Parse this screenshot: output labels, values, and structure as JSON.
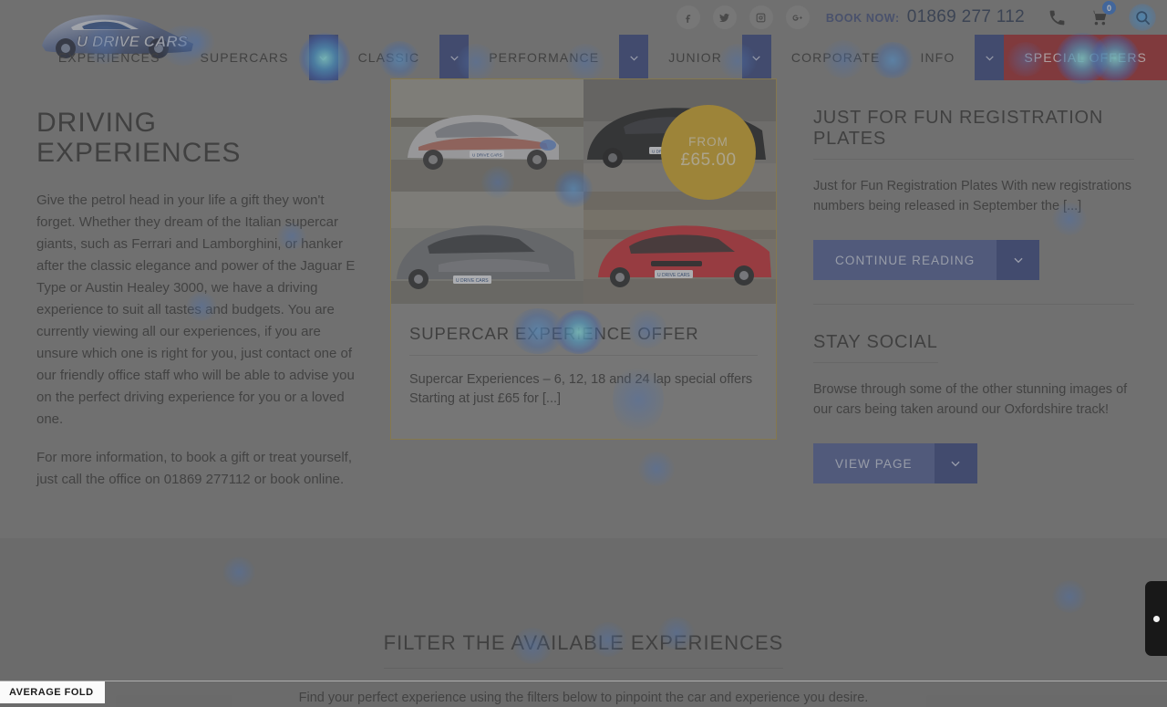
{
  "site": {
    "logo_text": "U DRIVE CARS",
    "logo_icon": "car-logo-icon"
  },
  "topbar": {
    "social": [
      {
        "name": "facebook-icon",
        "label": "f"
      },
      {
        "name": "twitter-icon",
        "label": "t"
      },
      {
        "name": "instagram-icon",
        "label": "i"
      },
      {
        "name": "googleplus-icon",
        "label": "g+"
      }
    ],
    "book_now_label": "BOOK NOW:",
    "phone": "01869 277 112",
    "phone_icon": "phone-icon",
    "cart_icon": "cart-icon",
    "cart_count": "0",
    "search_icon": "search-icon"
  },
  "nav": {
    "items": [
      {
        "label": "EXPERIENCES",
        "caret": false
      },
      {
        "label": "SUPERCARS",
        "caret": true
      },
      {
        "label": "CLASSIC",
        "caret": true
      },
      {
        "label": "PERFORMANCE",
        "caret": true
      },
      {
        "label": "JUNIOR",
        "caret": true
      },
      {
        "label": "CORPORATE",
        "caret": false
      },
      {
        "label": "INFO",
        "caret": true
      }
    ],
    "special_offers": "SPECIAL OFFERS",
    "caret_icon": "chevron-down-icon",
    "accent_blue": "#2e3f7f",
    "accent_red": "#9e1f26"
  },
  "left": {
    "title": "DRIVING EXPERIENCES",
    "paragraph1": "Give the petrol head in your life a gift they won't forget. Whether they dream of the Italian supercar giants, such as Ferrari and Lamborghini, or hanker after the classic elegance and power of the Jaguar E Type or Austin Healey 3000, we have a driving experience to suit all tastes and budgets. You are currently viewing all our experiences, if you are unsure which one is right for you, just contact one of our friendly office staff who will be able to advise you on the perfect driving experience for you or a loved one.",
    "paragraph2": "For more information, to book a gift or treat yourself, just call the office on 01869 277112 or book online."
  },
  "card": {
    "badge_label": "FROM",
    "badge_price": "£65.00",
    "badge_color": "#d4a61e",
    "border_color": "#a89144",
    "title": "SUPERCAR EXPERIENCE OFFER",
    "excerpt": "Supercar Experiences – 6, 12, 18 and 24 lap special offers Starting at just £65 for [...]",
    "images": [
      {
        "name": "thumb-silver-ferrari",
        "alt": "Silver supercar on track"
      },
      {
        "name": "thumb-black-supercar",
        "alt": "Black supercar on track"
      },
      {
        "name": "thumb-grey-aston",
        "alt": "Grey Aston Martin on track"
      },
      {
        "name": "thumb-red-audi",
        "alt": "Red Audi R8 on track"
      }
    ]
  },
  "widgets": [
    {
      "title": "JUST FOR FUN REGISTRATION PLATES",
      "text": "Just for Fun Registration Plates   With new registrations numbers being released in September the [...]",
      "button": "CONTINUE READING",
      "button_caret_icon": "chevron-down-icon"
    },
    {
      "title": "STAY SOCIAL",
      "text": "Browse through some of the other stunning images of our cars being taken around our Oxfordshire track!",
      "button": "VIEW PAGE",
      "button_caret_icon": "chevron-down-icon"
    }
  ],
  "lower": {
    "heading": "FILTER THE AVAILABLE EXPERIENCES",
    "subheading": "Find your perfect experience using the filters below to pinpoint the car and experience you desire."
  },
  "overlay": {
    "fold_label": "AVERAGE FOLD",
    "edge_tab_name": "feedback-tab"
  }
}
